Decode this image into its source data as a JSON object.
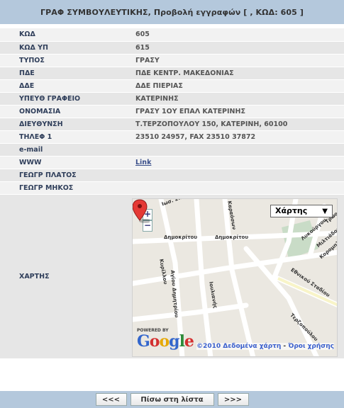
{
  "header": {
    "title": "ΓΡΑΦ ΣΥΜΒΟΥΛΕΥΤΙΚΗΣ, Προβολή εγγραφών [ , ΚΩΔ: 605 ]"
  },
  "fields": [
    {
      "label": "ΚΩΔ",
      "value": "605"
    },
    {
      "label": "ΚΩΔ ΥΠ",
      "value": "615"
    },
    {
      "label": "ΤΥΠΟΣ",
      "value": "ΓΡΑΣΥ"
    },
    {
      "label": "ΠΔΕ",
      "value": "ΠΔΕ ΚΕΝΤΡ. ΜΑΚΕΔΟΝΙΑΣ"
    },
    {
      "label": "ΔΔΕ",
      "value": "ΔΔΕ ΠΙΕΡΙΑΣ"
    },
    {
      "label": "ΥΠΕΥΘ ΓΡΑΦΕΙΟ",
      "value": "ΚΑΤΕΡΙΝΗΣ"
    },
    {
      "label": "ΟΝΟΜΑΣΙΑ",
      "value": "ΓΡΑΣΥ 1ΟΥ ΕΠΑΛ ΚΑΤΕΡΙΝΗΣ"
    },
    {
      "label": "ΔΙΕΥΘΥΝΣΗ",
      "value": "Τ.ΤΕΡΖΟΠΟΥΛΟΥ 150, ΚΑΤΕΡΙΝΗ, 60100"
    },
    {
      "label": "ΤΗΛΕΦ 1",
      "value": "23510 24957, FAX 23510 37872"
    },
    {
      "label": "e-mail",
      "value": ""
    },
    {
      "label": "WWW",
      "value": "Link"
    },
    {
      "label": "ΓΕΩΓΡ ΠΛΑΤΟΣ",
      "value": ""
    },
    {
      "label": "ΓΕΩΓΡ ΜΗΚΟΣ",
      "value": ""
    }
  ],
  "map": {
    "label": "ΧΑΡΤΗΣ",
    "type_selector": "Χάρτης",
    "zoom_in": "+",
    "zoom_out": "−",
    "powered_by": "POWERED BY",
    "copyright": "©2010 Δεδομένα χάρτη",
    "terms": "Όροι χρήσης",
    "streets": [
      "Δημοκρίτου",
      "Δημοκρίτου",
      "Αγίου Δημητρίου",
      "Κυρίλλου",
      "Ιουλιανής",
      "Τερζοπούλου",
      "Εθνικού Σταδίου",
      "Λυκούργου",
      "Μιλτιάδου",
      "Κορομηλά",
      "Τρώος",
      "Καραόσων",
      "Ιωσ. Σπ."
    ]
  },
  "footer": {
    "prev": "<<<",
    "back": "Πίσω στη λίστα",
    "next": ">>>"
  }
}
